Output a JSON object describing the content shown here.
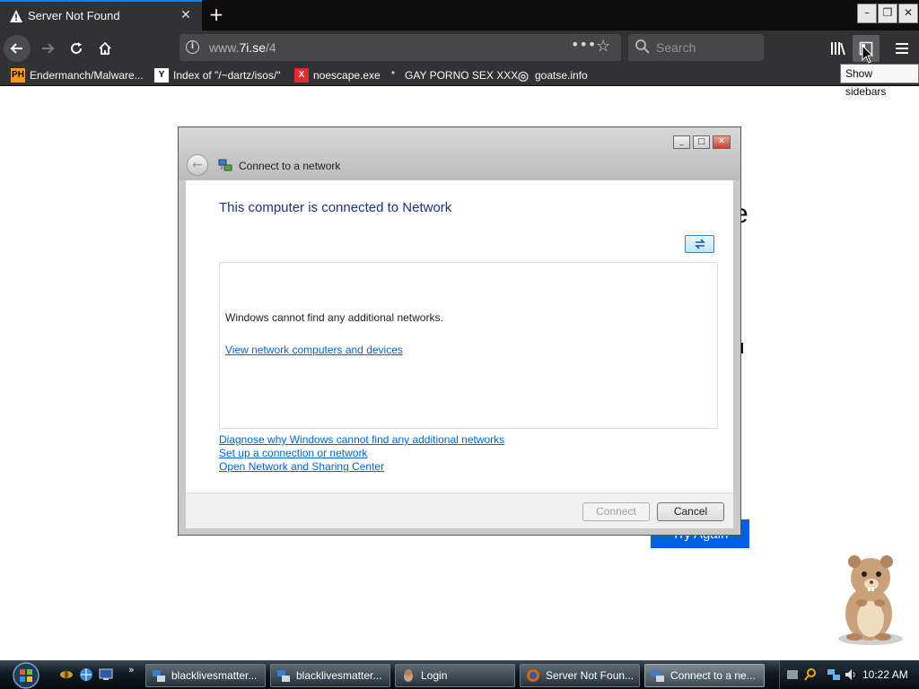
{
  "browser": {
    "tab": {
      "title": "Server Not Found",
      "close": "✕"
    },
    "newtab": "+",
    "window_controls": {
      "minimize": "–",
      "restore": "❐",
      "close": "✕"
    },
    "url": {
      "host_prefix": "www.",
      "host": "7i.se",
      "path": "/4"
    },
    "search": {
      "placeholder": "Search"
    },
    "bookmarks": [
      {
        "icon": "PH",
        "label": "Endermanch/Malware..."
      },
      {
        "icon": "Y",
        "label": "Index of \"/~dartz/isos/\""
      },
      {
        "icon": "X",
        "label": "noescape.exe"
      },
      {
        "icon": "*",
        "label": "GAY PORNO SEX XXX"
      },
      {
        "icon": "◎",
        "label": "goatse.info"
      }
    ],
    "tooltip": "Show sidebars"
  },
  "page": {
    "peek_letter": "e",
    "try_again": "Try Again"
  },
  "dialog": {
    "title": "Connect to a network",
    "heading": "This computer is connected to Network",
    "list_message": "Windows cannot find any additional networks.",
    "list_link": "View network computers and devices",
    "links": [
      "Diagnose why Windows cannot find any additional networks",
      "Set up a connection or network",
      "Open Network and Sharing Center"
    ],
    "connect": "Connect",
    "cancel": "Cancel"
  },
  "taskbar": {
    "buttons": [
      {
        "label": "blacklivesmatter..."
      },
      {
        "label": "blacklivesmatter..."
      },
      {
        "label": "Login"
      },
      {
        "label": "Server Not Foun..."
      },
      {
        "label": "Connect to a ne..."
      }
    ],
    "quicklaunch_more": "»",
    "clock": "10:22 AM"
  },
  "colors": {
    "firefox_tab_accent": "#0a84ff",
    "firefox_toolbar": "#323234",
    "try_again_blue": "#0060df",
    "vista_link": "#0066cc",
    "vista_heading": "#1e3287"
  }
}
